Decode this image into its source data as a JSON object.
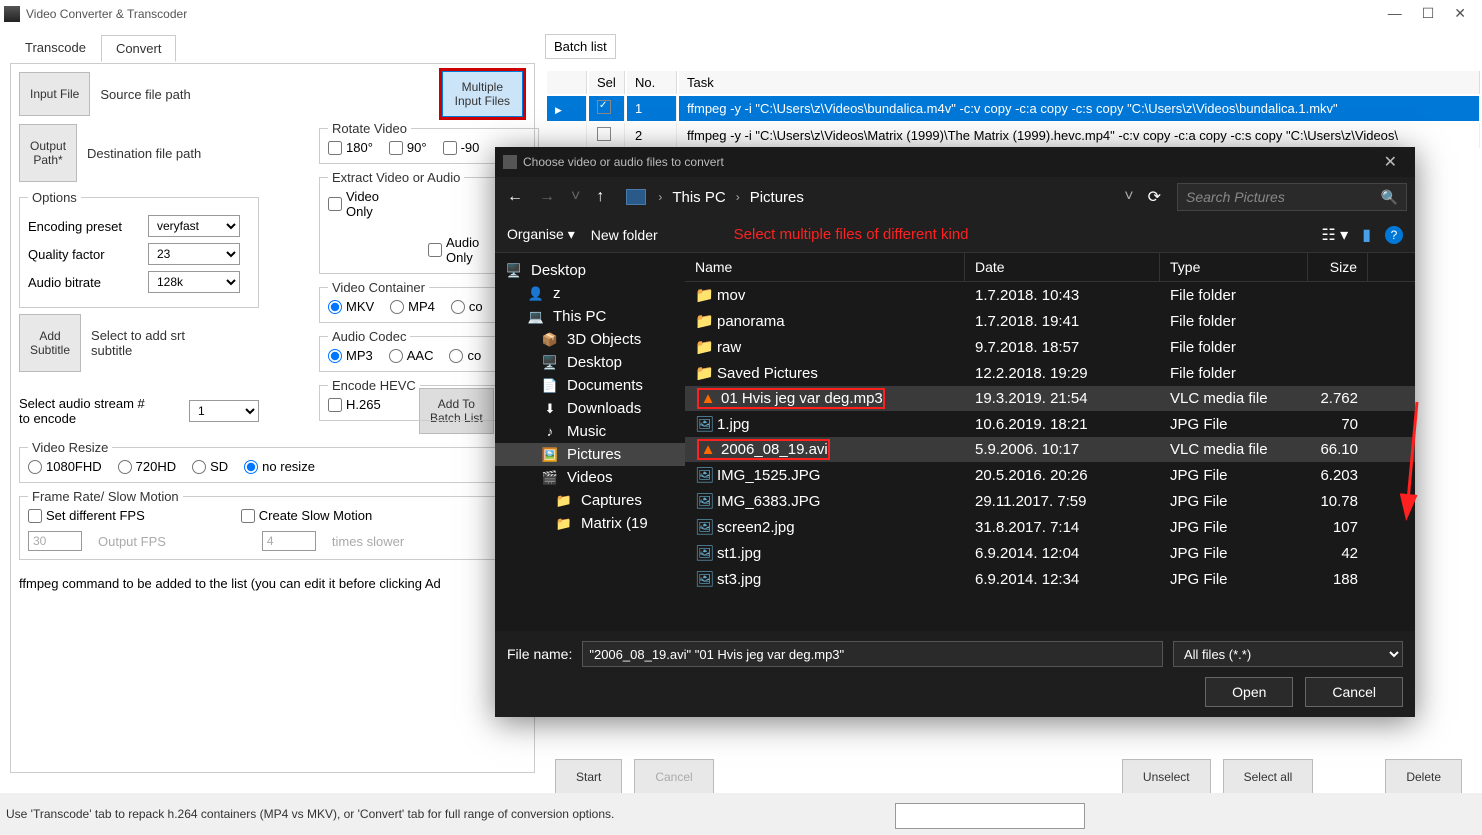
{
  "window": {
    "title": "Video Converter & Transcoder"
  },
  "tabs": {
    "transcode": "Transcode",
    "convert": "Convert"
  },
  "buttons": {
    "input_file": "Input File",
    "output_path": "Output\nPath*",
    "multi_input": "Multiple\nInput Files",
    "add_subtitle": "Add\nSubtitle",
    "add_batch": "Add To\nBatch List"
  },
  "labels": {
    "source_path": "Source file path",
    "dest_path": "Destination file path",
    "rotate": "Rotate Video",
    "rot180": "180°",
    "rot90": "90°",
    "rotn90": "-90",
    "extract": "Extract Video or Audio",
    "video_only": "Video\nOnly",
    "audio_only": "Audio\nOnly",
    "options": "Options",
    "enc_preset": "Encoding preset",
    "quality": "Quality factor",
    "audio_bitrate": "Audio bitrate",
    "srt": "Select to add srt\nsubtitle",
    "vcontainer": "Video Container",
    "mkv": "MKV",
    "mp4": "MP4",
    "co": "co",
    "acodec": "Audio Codec",
    "mp3": "MP3",
    "aac": "AAC",
    "hevc": "Encode HEVC",
    "h265": "H.265",
    "audio_stream": "Select audio stream #\nto encode",
    "resize": "Video Resize",
    "r1080": "1080FHD",
    "r720": "720HD",
    "rsd": "SD",
    "rnone": "no resize",
    "fps_group": "Frame Rate/ Slow Motion",
    "set_fps": "Set different FPS",
    "slow_motion": "Create Slow Motion",
    "output_fps": "Output FPS",
    "times_slower": "times slower",
    "ffmpeg_cmd": "ffmpeg command to be added to the list (you can edit it before clicking Ad"
  },
  "values": {
    "preset": "veryfast",
    "quality": "23",
    "bitrate": "128k",
    "stream": "1",
    "fps": "30",
    "slow": "4"
  },
  "batch": {
    "title": "Batch list",
    "cols": {
      "sel": "Sel",
      "no": "No.",
      "task": "Task"
    },
    "rows": [
      {
        "no": "1",
        "task": "ffmpeg -y -i \"C:\\Users\\z\\Videos\\bundalica.m4v\" -c:v copy -c:a copy -c:s copy \"C:\\Users\\z\\Videos\\bundalica.1.mkv\"",
        "sel": true,
        "checked": true
      },
      {
        "no": "2",
        "task": "ffmpeg -y -i \"C:\\Users\\z\\Videos\\Matrix (1999)\\The Matrix (1999).hevc.mp4\" -c:v copy -c:a copy -c:s copy \"C:\\Users\\z\\Videos\\",
        "sel": false,
        "checked": false
      }
    ],
    "btns": {
      "start": "Start",
      "cancel": "Cancel",
      "unselect": "Unselect",
      "select_all": "Select all",
      "delete": "Delete"
    }
  },
  "status": "Use 'Transcode' tab to repack h.264 containers (MP4 vs MKV), or 'Convert' tab for full range of conversion options.",
  "dialog": {
    "title": "Choose video or audio files to convert",
    "path": {
      "thispc": "This PC",
      "folder": "Pictures"
    },
    "search_placeholder": "Search Pictures",
    "toolbar": {
      "organise": "Organise",
      "newfolder": "New folder"
    },
    "annotation": "Select multiple files of different kind",
    "tree": [
      {
        "name": "Desktop",
        "icon": "desktop",
        "indent": 0
      },
      {
        "name": "z",
        "icon": "user",
        "indent": 1
      },
      {
        "name": "This PC",
        "icon": "thispc",
        "indent": 1
      },
      {
        "name": "3D Objects",
        "icon": "3d",
        "indent": 2
      },
      {
        "name": "Desktop",
        "icon": "desktop",
        "indent": 2
      },
      {
        "name": "Documents",
        "icon": "doc",
        "indent": 2
      },
      {
        "name": "Downloads",
        "icon": "dl",
        "indent": 2
      },
      {
        "name": "Music",
        "icon": "music",
        "indent": 2
      },
      {
        "name": "Pictures",
        "icon": "pic",
        "indent": 2,
        "sel": true
      },
      {
        "name": "Videos",
        "icon": "vid",
        "indent": 2
      },
      {
        "name": "Captures",
        "icon": "folder",
        "indent": 3
      },
      {
        "name": "Matrix (19",
        "icon": "folder",
        "indent": 3
      }
    ],
    "list_hdr": {
      "name": "Name",
      "date": "Date",
      "type": "Type",
      "size": "Size"
    },
    "files": [
      {
        "name": "mov",
        "date": "1.7.2018. 10:43",
        "type": "File folder",
        "size": "",
        "icon": "folder"
      },
      {
        "name": "panorama",
        "date": "1.7.2018. 19:41",
        "type": "File folder",
        "size": "",
        "icon": "folder"
      },
      {
        "name": "raw",
        "date": "9.7.2018. 18:57",
        "type": "File folder",
        "size": "",
        "icon": "folder"
      },
      {
        "name": "Saved Pictures",
        "date": "12.2.2018. 19:29",
        "type": "File folder",
        "size": "",
        "icon": "folder"
      },
      {
        "name": "01 Hvis jeg var deg.mp3",
        "date": "19.3.2019. 21:54",
        "type": "VLC media file",
        "size": "2.762",
        "icon": "vlc",
        "sel": true,
        "redbox": true
      },
      {
        "name": "1.jpg",
        "date": "10.6.2019. 18:21",
        "type": "JPG File",
        "size": "70",
        "icon": "img"
      },
      {
        "name": "2006_08_19.avi",
        "date": "5.9.2006. 10:17",
        "type": "VLC media file",
        "size": "66.10",
        "icon": "vlc",
        "sel": true,
        "redbox": true
      },
      {
        "name": "IMG_1525.JPG",
        "date": "20.5.2016. 20:26",
        "type": "JPG File",
        "size": "6.203",
        "icon": "img"
      },
      {
        "name": "IMG_6383.JPG",
        "date": "29.11.2017. 7:59",
        "type": "JPG File",
        "size": "10.78",
        "icon": "img"
      },
      {
        "name": "screen2.jpg",
        "date": "31.8.2017. 7:14",
        "type": "JPG File",
        "size": "107",
        "icon": "img"
      },
      {
        "name": "st1.jpg",
        "date": "6.9.2014. 12:04",
        "type": "JPG File",
        "size": "42",
        "icon": "img"
      },
      {
        "name": "st3.jpg",
        "date": "6.9.2014. 12:34",
        "type": "JPG File",
        "size": "188",
        "icon": "img"
      }
    ],
    "filename_label": "File name:",
    "filename": "\"2006_08_19.avi\" \"01 Hvis jeg var deg.mp3\"",
    "filter": "All files (*.*)",
    "open": "Open",
    "cancel": "Cancel"
  }
}
